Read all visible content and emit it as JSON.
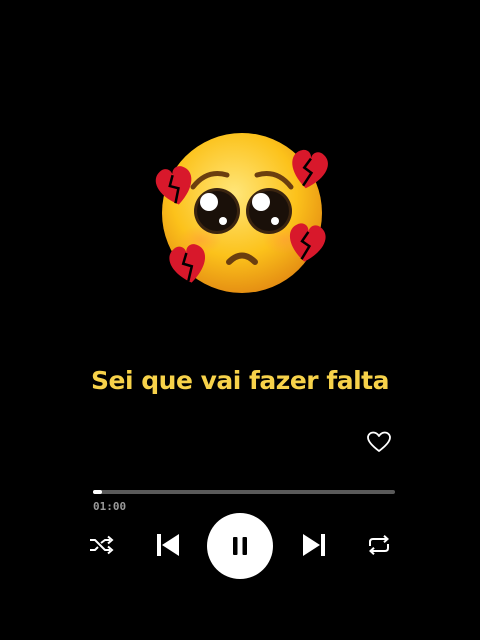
{
  "player": {
    "artwork_icon": "pleading-face-with-broken-hearts",
    "lyric": "Sei que vai fazer falta",
    "elapsed": "01:00",
    "progress_fraction": 0.03,
    "state": "playing"
  },
  "controls": {
    "like_icon": "heart-outline-icon",
    "shuffle_icon": "shuffle-icon",
    "previous_icon": "skip-previous-icon",
    "play_pause_icon": "pause-icon",
    "next_icon": "skip-next-icon",
    "repeat_icon": "repeat-icon"
  },
  "colors": {
    "background": "#000000",
    "lyric": "#f7d24a",
    "track": "#5a5a5a",
    "fill": "#ffffff",
    "elapsed": "#9a9a9a",
    "heart": "#d8182b"
  }
}
